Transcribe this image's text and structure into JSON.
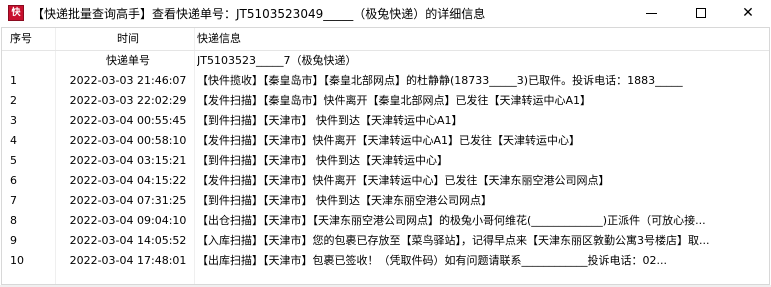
{
  "window": {
    "title": "【快递批量查询高手】查看快递单号：JT5103523049_____（极兔快递）的详细信息",
    "icon_glyph": "快",
    "minimize_label": "—",
    "maximize_label": "☐",
    "close_label": "✕"
  },
  "table": {
    "columns": [
      "序号",
      "时间",
      "快递信息"
    ],
    "sub_header": {
      "label": "快递单号",
      "value": "JT5103523_____7（极兔快递）"
    },
    "rows": [
      {
        "no": "1",
        "time": "2022-03-03 21:46:07",
        "info": "【快件揽收】【秦皇岛市】【秦皇北部网点】的杜静静(18733_____3)已取件。投诉电话：1883_____"
      },
      {
        "no": "2",
        "time": "2022-03-03 22:02:29",
        "info": "【发件扫描】【秦皇岛市】快件离开【秦皇北部网点】已发往【天津转运中心A1】"
      },
      {
        "no": "3",
        "time": "2022-03-04 00:55:45",
        "info": "【到件扫描】【天津市】 快件到达【天津转运中心A1】"
      },
      {
        "no": "4",
        "time": "2022-03-04 00:58:10",
        "info": "【发件扫描】【天津市】快件离开【天津转运中心A1】已发往【天津转运中心】"
      },
      {
        "no": "5",
        "time": "2022-03-04 03:15:21",
        "info": "【到件扫描】【天津市】 快件到达【天津转运中心】"
      },
      {
        "no": "6",
        "time": "2022-03-04 04:15:22",
        "info": "【发件扫描】【天津市】快件离开【天津转运中心】已发往【天津东丽空港公司网点】"
      },
      {
        "no": "7",
        "time": "2022-03-04 07:31:25",
        "info": "【到件扫描】【天津市】 快件到达【天津东丽空港公司网点】"
      },
      {
        "no": "8",
        "time": "2022-03-04 09:04:10",
        "info": "【出仓扫描】【天津市】【天津东丽空港公司网点】的极兔小哥何维花(_____________)正派件（可放心接..."
      },
      {
        "no": "9",
        "time": "2022-03-04 14:05:52",
        "info": "【入库扫描】【天津市】您的包裹已存放至【菜鸟驿站】，记得早点来【天津东丽区敦勤公寓3号楼店】取..."
      },
      {
        "no": "10",
        "time": "2022-03-04 17:48:01",
        "info": "【出库扫描】【天津市】包裹已签收！（凭取件码）如有问题请联系____________投诉电话：02..."
      }
    ]
  }
}
